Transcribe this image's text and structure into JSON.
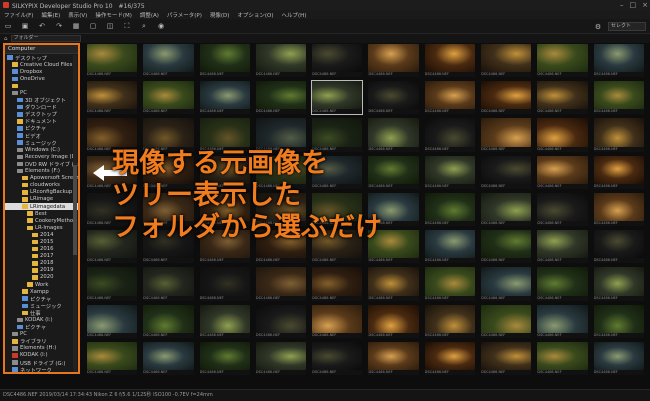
{
  "window": {
    "title": "SILKYPIX Developer Studio Pro 10　#16/375"
  },
  "menu": [
    "ファイル(F)",
    "編集(E)",
    "表示(V)",
    "操作モード(M)",
    "調整(A)",
    "パラメータ(P)",
    "現像(D)",
    "オプション(O)",
    "ヘルプ(H)"
  ],
  "subbar": {
    "dropdown": "フォルダー"
  },
  "toolbar": {
    "right_field": "セレクト"
  },
  "folder_panel": {
    "header": "Computer",
    "items": [
      {
        "label": "デスクトップ",
        "icon": "special",
        "indent": 0
      },
      {
        "label": "Creative Cloud Files",
        "icon": "folder",
        "indent": 1
      },
      {
        "label": "Dropbox",
        "icon": "special",
        "indent": 1
      },
      {
        "label": "OneDrive",
        "icon": "special",
        "indent": 1
      },
      {
        "label": "",
        "icon": "folder",
        "indent": 1
      },
      {
        "label": "PC",
        "icon": "drive",
        "indent": 1
      },
      {
        "label": "3D オブジェクト",
        "icon": "special",
        "indent": 2
      },
      {
        "label": "ダウンロード",
        "icon": "special",
        "indent": 2
      },
      {
        "label": "デスクトップ",
        "icon": "special",
        "indent": 2
      },
      {
        "label": "ドキュメント",
        "icon": "folder",
        "indent": 2
      },
      {
        "label": "ピクチャ",
        "icon": "special",
        "indent": 2
      },
      {
        "label": "ビデオ",
        "icon": "special",
        "indent": 2
      },
      {
        "label": "ミュージック",
        "icon": "special",
        "indent": 2
      },
      {
        "label": "Windows (C:)",
        "icon": "drive",
        "indent": 2
      },
      {
        "label": "Recovery Image (D:)",
        "icon": "drive",
        "indent": 2
      },
      {
        "label": "DVD RW ドライブ (E:)",
        "icon": "drive",
        "indent": 2
      },
      {
        "label": "Elements (F:)",
        "icon": "drive",
        "indent": 2
      },
      {
        "label": "Apowersoft Screen",
        "icon": "folder",
        "indent": 3
      },
      {
        "label": "cloudworks",
        "icon": "folder",
        "indent": 3
      },
      {
        "label": "LRconfigBackup",
        "icon": "folder",
        "indent": 3
      },
      {
        "label": "LRimage",
        "icon": "folder",
        "indent": 3
      },
      {
        "label": "LRimagedata",
        "icon": "folder",
        "indent": 3,
        "selected": true
      },
      {
        "label": "Best",
        "icon": "folder",
        "indent": 4
      },
      {
        "label": "CookeryMetho",
        "icon": "folder",
        "indent": 4
      },
      {
        "label": "LR-Images",
        "icon": "folder",
        "indent": 4
      },
      {
        "label": "2014",
        "icon": "folder",
        "indent": 5
      },
      {
        "label": "2015",
        "icon": "folder",
        "indent": 5
      },
      {
        "label": "2016",
        "icon": "folder",
        "indent": 5
      },
      {
        "label": "2017",
        "icon": "folder",
        "indent": 5
      },
      {
        "label": "2018",
        "icon": "folder",
        "indent": 5
      },
      {
        "label": "2019",
        "icon": "folder",
        "indent": 5
      },
      {
        "label": "2020",
        "icon": "folder",
        "indent": 5
      },
      {
        "label": "Work",
        "icon": "folder",
        "indent": 4
      },
      {
        "label": "Xampp",
        "icon": "folder",
        "indent": 3
      },
      {
        "label": "ピクチャ",
        "icon": "special",
        "indent": 3
      },
      {
        "label": "ミュージック",
        "icon": "special",
        "indent": 3
      },
      {
        "label": "仕事",
        "icon": "folder",
        "indent": 3
      },
      {
        "label": "KODAK (I:)",
        "icon": "drive",
        "indent": 2
      },
      {
        "label": "ピクチャ",
        "icon": "special",
        "indent": 2
      },
      {
        "label": "PC",
        "icon": "drive",
        "indent": 1
      },
      {
        "label": "ライブラリ",
        "icon": "folder",
        "indent": 1
      },
      {
        "label": "Elements (H:)",
        "icon": "drive",
        "indent": 1
      },
      {
        "label": "KODAK (I:)",
        "icon": "red",
        "indent": 1
      },
      {
        "label": "USB ドライブ (G:)",
        "icon": "drive",
        "indent": 1
      },
      {
        "label": "ネットワーク",
        "icon": "special",
        "indent": 1
      }
    ]
  },
  "overlay": {
    "lines": [
      "現像する元画像を",
      "ツリー表示した",
      "フォルダから選ぶだけ"
    ],
    "color": "#f07c1e"
  },
  "status": {
    "text": "DSC4486.NEF  2019/03/14 17:34:43  Nikon Z 6  f/5.6  1/125秒  ISO100  -0.7EV  f=24mm"
  },
  "thumbnail_caption": "DSC4486.NEF"
}
